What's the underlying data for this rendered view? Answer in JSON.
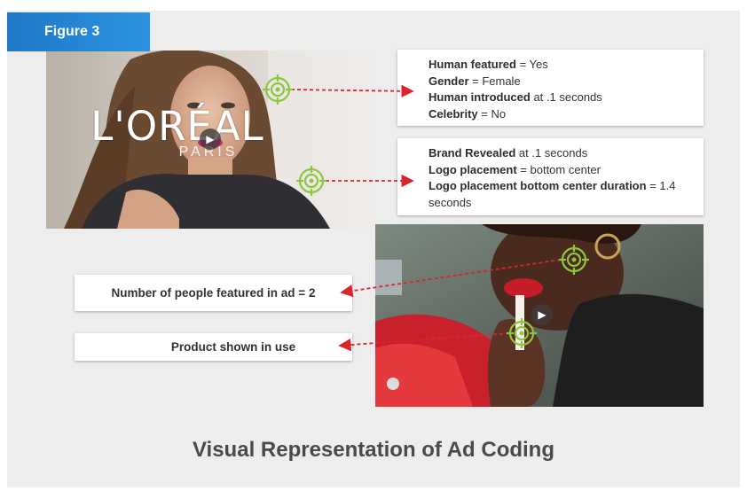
{
  "figure_label": "Figure 3",
  "brand": {
    "wordmark": "L'ORÉAL",
    "sub": "PARIS"
  },
  "info_box_1": [
    {
      "key": "Human featured",
      "rest": " = Yes"
    },
    {
      "key": "Gender",
      "rest": " = Female"
    },
    {
      "key": "Human introduced",
      "rest": " at .1 seconds"
    },
    {
      "key": "Celebrity",
      "rest": " = No"
    }
  ],
  "info_box_2": [
    {
      "key": "Brand Revealed",
      "rest": " at .1 seconds"
    },
    {
      "key": "Logo placement",
      "rest": " = bottom center"
    },
    {
      "key": "Logo placement bottom center duration",
      "rest": " = 1.4 seconds"
    }
  ],
  "people_count_label": "Number of people featured in ad = 2",
  "product_label": "Product shown in use",
  "caption": "Visual Representation of Ad Coding",
  "icons": {
    "target": "crosshair-target-icon",
    "play": "play-icon"
  },
  "colors": {
    "tab": "#2a8ad8",
    "target": "#8dc63f",
    "connector": "#d9262c"
  }
}
